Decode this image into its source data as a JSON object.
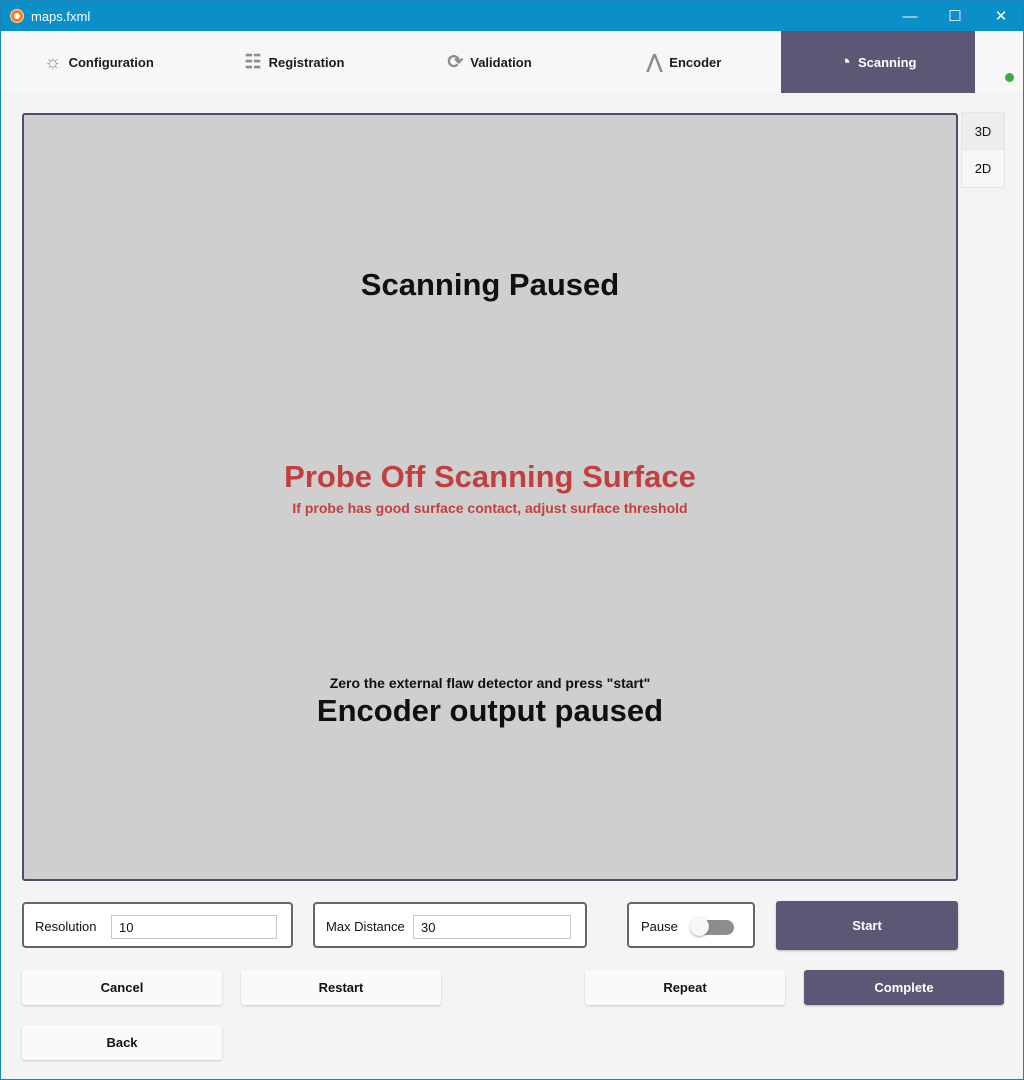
{
  "window": {
    "title": "maps.fxml",
    "controls": {
      "minimize": "—",
      "maximize": "☐",
      "close": "✕"
    }
  },
  "tabs": [
    {
      "label": "Configuration",
      "icon": "sun-icon",
      "glyph": "☼"
    },
    {
      "label": "Registration",
      "icon": "sliders-icon",
      "glyph": "☷"
    },
    {
      "label": "Validation",
      "icon": "refresh-icon",
      "glyph": "⟳"
    },
    {
      "label": "Encoder",
      "icon": "peaks-icon",
      "glyph": "⋀"
    },
    {
      "label": "Scanning",
      "icon": "gauge-icon",
      "glyph": "◔"
    }
  ],
  "main": {
    "status_title": "Scanning Paused",
    "warning_title": "Probe Off Scanning Surface",
    "warning_subtitle": "If probe has good surface contact, adjust surface threshold",
    "instruction": "Zero the external flaw detector and press \"start\"",
    "encoder_status": "Encoder output paused"
  },
  "view_modes": {
    "3d": "3D",
    "2d": "2D"
  },
  "controls": {
    "resolution_label": "Resolution",
    "resolution_value": "10",
    "max_distance_label": "Max Distance",
    "max_distance_value": "30",
    "pause_label": "Pause",
    "start_label": "Start"
  },
  "buttons": {
    "cancel": "Cancel",
    "restart": "Restart",
    "repeat": "Repeat",
    "complete": "Complete",
    "back": "Back"
  },
  "colors": {
    "accent": "#5a5874",
    "warning": "#c23f3f",
    "status": "#3ea84b"
  }
}
